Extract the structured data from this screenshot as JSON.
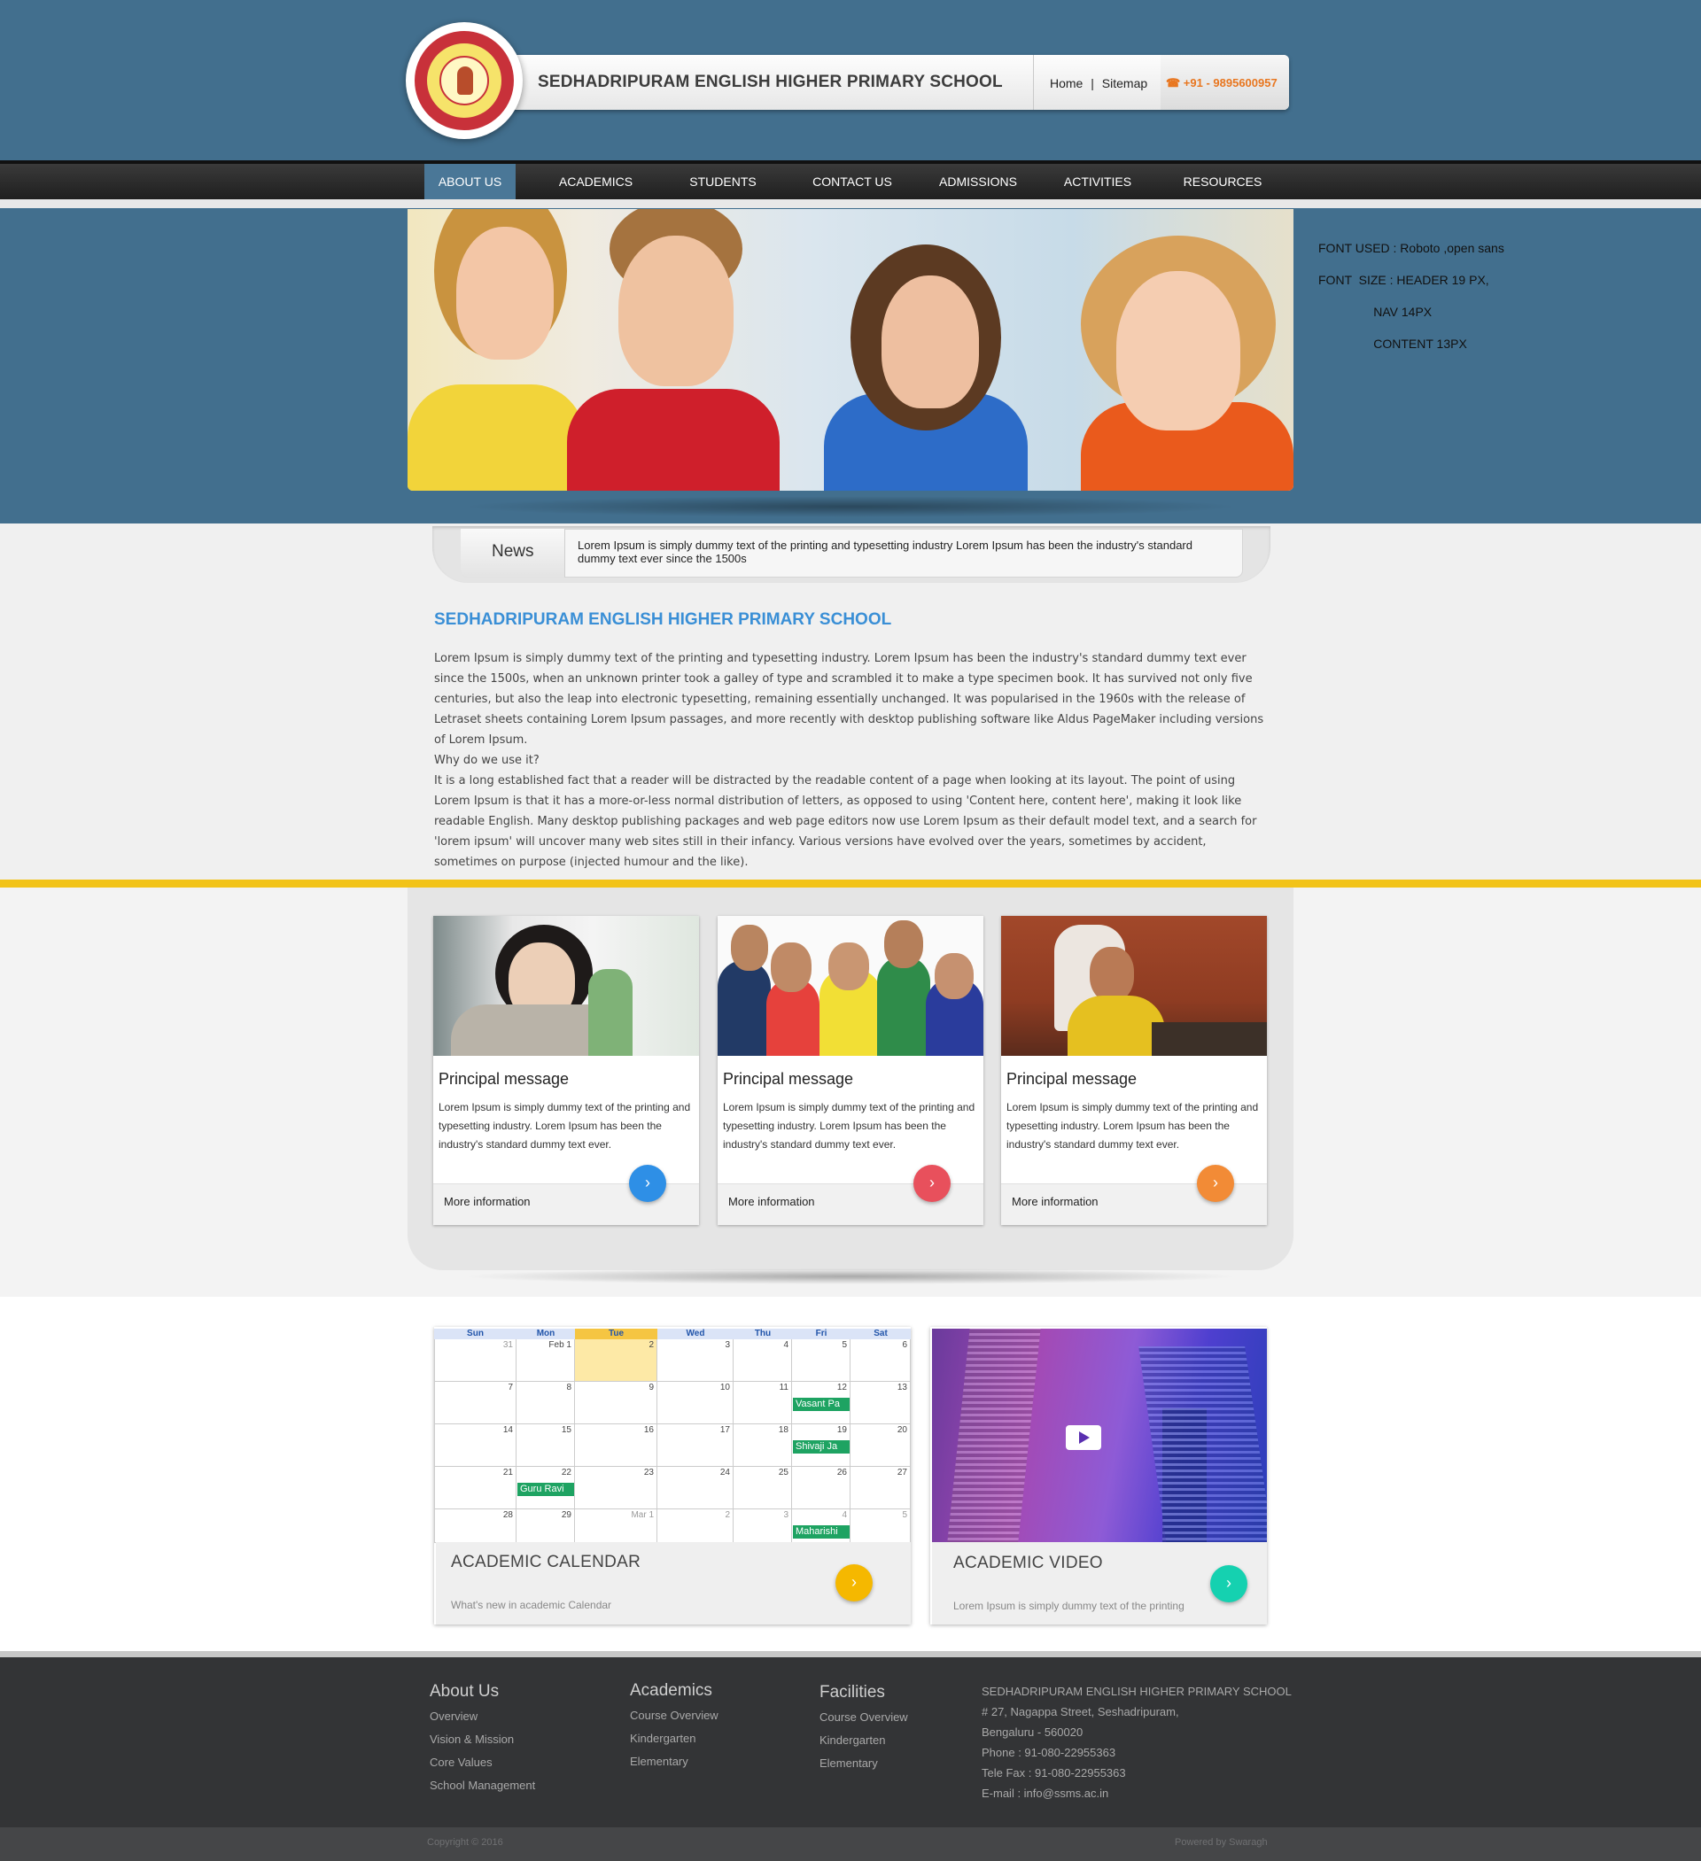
{
  "header": {
    "school_name": "SEDHADRIPURAM ENGLISH  HIGHER PRIMARY SCHOOL",
    "links": [
      "Home",
      "|",
      "Sitemap"
    ],
    "phone": "☎ +91 - 9895600957"
  },
  "nav": {
    "items": [
      "ABOUT US",
      "ACADEMICS",
      "STUDENTS",
      "CONTACT US",
      "ADMISSIONS",
      "ACTIVITIES",
      "RESOURCES"
    ],
    "active": "ABOUT US"
  },
  "font_notes": {
    "line1": "FONT USED : Roboto ,open sans",
    "line2": "FONT  SIZE : HEADER 19 PX,",
    "line3": "                NAV 14PX",
    "line4": "                CONTENT 13PX"
  },
  "news": {
    "label": "News",
    "text": "Lorem Ipsum is simply dummy text of the printing and typesetting industry Lorem Ipsum has been the industry's standard dummy text ever since the 1500s"
  },
  "about": {
    "title": "SEDHADRIPURAM ENGLISH HIGHER PRIMARY SCHOOL",
    "para1": "Lorem Ipsum is simply dummy text of the printing and typesetting industry. Lorem Ipsum has been the industry's standard dummy text ever since the 1500s, when an unknown printer took a galley of type and scrambled it to make a type specimen book. It has survived not only five centuries, but also the leap into electronic typesetting, remaining essentially unchanged. It was popularised in the 1960s with the release of Letraset sheets containing Lorem Ipsum passages, and more recently with desktop publishing software like Aldus PageMaker including versions of Lorem Ipsum.",
    "question": "Why do we use it?",
    "para2": "It is a long established fact that a reader will be distracted by the readable content of a page when looking at its layout. The point of using Lorem Ipsum is that it has a more-or-less normal distribution of letters, as opposed to using 'Content here, content here', making it look like readable English. Many desktop publishing packages and web page editors now use Lorem Ipsum as their default model text, and a search for 'lorem ipsum' will uncover many web sites still in their infancy. Various versions have evolved over the years, sometimes by accident, sometimes on purpose (injected humour and the like)."
  },
  "cards": [
    {
      "title": "Principal message",
      "text": "Lorem Ipsum is simply dummy text of the printing and typesetting industry. Lorem Ipsum has been the industry's standard dummy text ever.",
      "more": "More information",
      "button_color": "#2e8fe6",
      "button_icon": "›"
    },
    {
      "title": "Principal message",
      "text": "Lorem Ipsum is simply dummy text of the printing and typesetting industry. Lorem Ipsum has been the industry's standard dummy text ever.",
      "more": "More information",
      "button_color": "#e8505c",
      "button_icon": "›"
    },
    {
      "title": "Principal message",
      "text": "Lorem Ipsum is simply dummy text of the printing and typesetting industry. Lorem Ipsum has been the industry's standard dummy text ever.",
      "more": "More information",
      "button_color": "#f28b36",
      "button_icon": "›"
    }
  ],
  "calendar": {
    "days": [
      "Sun",
      "Mon",
      "Tue",
      "Wed",
      "Thu",
      "Fri",
      "Sat"
    ],
    "weeks": [
      [
        "31",
        "Feb 1",
        "2",
        "3",
        "4",
        "5",
        "6"
      ],
      [
        "7",
        "8",
        "9",
        "10",
        "11",
        "12",
        "13"
      ],
      [
        "14",
        "15",
        "16",
        "17",
        "18",
        "19",
        "20"
      ],
      [
        "21",
        "22",
        "23",
        "24",
        "25",
        "26",
        "27"
      ],
      [
        "28",
        "29",
        "Mar 1",
        "2",
        "3",
        "4",
        "5"
      ]
    ],
    "events": [
      "Vasant Pa",
      "Shivaji Ja",
      "Guru Ravi",
      "Maharishi"
    ],
    "title": "ACADEMIC CALENDAR",
    "subtitle": "What's new in academic Calendar",
    "button_color": "#f5b800",
    "today_color": "#fde9a6"
  },
  "video": {
    "title": "ACADEMIC VIDEO",
    "subtitle": "Lorem Ipsum is simply dummy text of the printing",
    "button_color": "#15d1b0"
  },
  "footer": {
    "about": {
      "heading": "About Us",
      "links": [
        "Overview",
        "Vision & Mission",
        "Core Values",
        "School Management"
      ]
    },
    "academics": {
      "heading": "Academics",
      "links": [
        "Course Overview",
        "Kindergarten",
        "Elementary"
      ]
    },
    "facilities": {
      "heading": "Facilities",
      "links": [
        "Course Overview",
        "Kindergarten",
        "Elementary"
      ]
    },
    "address": [
      "SEDHADRIPURAM ENGLISH HIGHER PRIMARY SCHOOL",
      "# 27, Nagappa Street, Seshadripuram,",
      "Bengaluru - 560020",
      "Phone : 91-080-22955363",
      "Tele Fax : 91-080-22955363",
      "E-mail : info@ssms.ac.in"
    ],
    "copyright": "Copyright © 2016",
    "powered": "Powered by Swaragh"
  }
}
